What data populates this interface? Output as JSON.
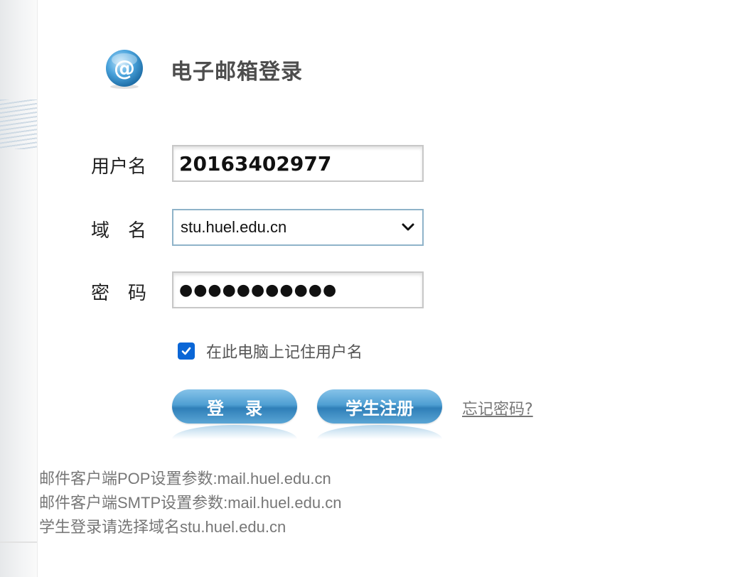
{
  "header": {
    "icon": "at-sign-icon",
    "title": "电子邮箱登录"
  },
  "form": {
    "username_label": "用户名",
    "username_value": "20163402977",
    "domain_label": "域名",
    "domain_value": "stu.huel.edu.cn",
    "password_label": "密码",
    "password_mask": "●●●●●●●●●●●",
    "remember_checked": true,
    "remember_label": "在此电脑上记住用户名"
  },
  "actions": {
    "login_label": "登录",
    "register_label": "学生注册",
    "forgot_label": "忘记密码?"
  },
  "info": {
    "pop": "邮件客户端POP设置参数:mail.huel.edu.cn",
    "smtp": "邮件客户端SMTP设置参数:mail.huel.edu.cn",
    "student_note": "学生登录请选择域名stu.huel.edu.cn"
  },
  "colors": {
    "button_blue": "#4f9fd3",
    "checkbox_blue": "#0a66d6",
    "select_border": "#8fb3c9"
  }
}
